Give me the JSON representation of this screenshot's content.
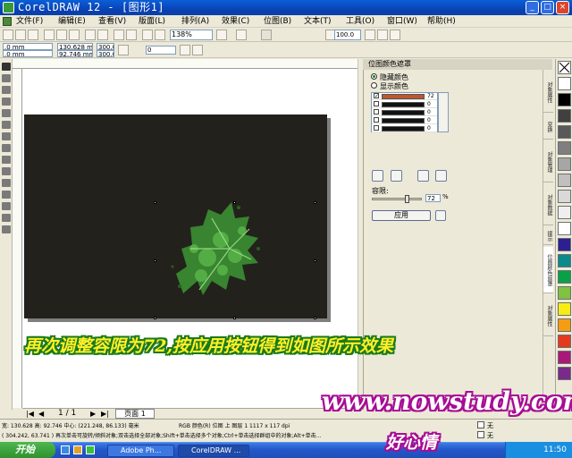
{
  "window": {
    "title": "CorelDRAW 12 - [图形1]"
  },
  "menu": [
    "文件(F)",
    "编辑(E)",
    "查看(V)",
    "版面(L)",
    "排列(A)",
    "效果(C)",
    "位图(B)",
    "文本(T)",
    "工具(O)",
    "窗口(W)",
    "帮助(H)"
  ],
  "toolbar": {
    "zoom": "138%",
    "outline_value": "100.0"
  },
  "propbar": {
    "x": "130.628 mm",
    "y": "92.746 mm",
    "w": "300.0",
    "h": "300.0",
    "angle": "0",
    "pos_x": ".0 mm",
    "pos_y": ".0 mm"
  },
  "docker": {
    "title": "位图颜色遮罩",
    "radio_hide": "隐藏颜色",
    "radio_show": "显示颜色",
    "colors": [
      {
        "checked": true,
        "color": "#c0552e",
        "value": "72"
      },
      {
        "checked": false,
        "color": "#111111",
        "value": "0"
      },
      {
        "checked": false,
        "color": "#111111",
        "value": "0"
      },
      {
        "checked": false,
        "color": "#111111",
        "value": "0"
      },
      {
        "checked": false,
        "color": "#111111",
        "value": "0"
      }
    ],
    "tolerance_label": "容限:",
    "tolerance_value": "72",
    "tolerance_unit": "%",
    "tolerance_level": 0.72,
    "apply_label": "应用",
    "side_tabs": [
      "对象属性",
      "变换",
      "对象管理",
      "对象数据",
      "提示",
      "位图颜色遮罩",
      "对象属性"
    ]
  },
  "palette": [
    "#ffffff",
    "#000000",
    "#404040",
    "#595959",
    "#7f7f7f",
    "#a6a6a6",
    "#c0c0c0",
    "#d9d9d9",
    "#efefef",
    "#ffffff",
    "#2d1f8f",
    "#0a8a8a",
    "#0aa047",
    "#7fc241",
    "#f7ec13",
    "#f59d12",
    "#e5391e",
    "#a8197a",
    "#7a2a8a"
  ],
  "page": {
    "page_indicator": "1 / 1",
    "page_tab": "页面 1"
  },
  "overlay": {
    "instruction": "再次调整容限为72,按应用按钮得到如图所示效果",
    "site": "www.nowstudy.com",
    "author": "好心情"
  },
  "status": {
    "line1": "宽: 130.628  高: 92.746  中心: (221.248, 86.133)  毫米",
    "line1b": "RGB 颜色(R) 位图 上 图层 1 1117 x 117 dpi",
    "line2": "( 304.242, 63.741 )  再次单击可旋转/倾斜对象;双击选择全部对象;Shift+单击选择多个对象;Ctrl+单击选择群组中的对象;Alt+单击...",
    "fill_none": "无",
    "outline_none": "无"
  },
  "taskbar": {
    "start": "开始",
    "tasks": [
      "Adobe Ph...",
      "CorelDRAW ..."
    ],
    "clock": "11:50"
  }
}
